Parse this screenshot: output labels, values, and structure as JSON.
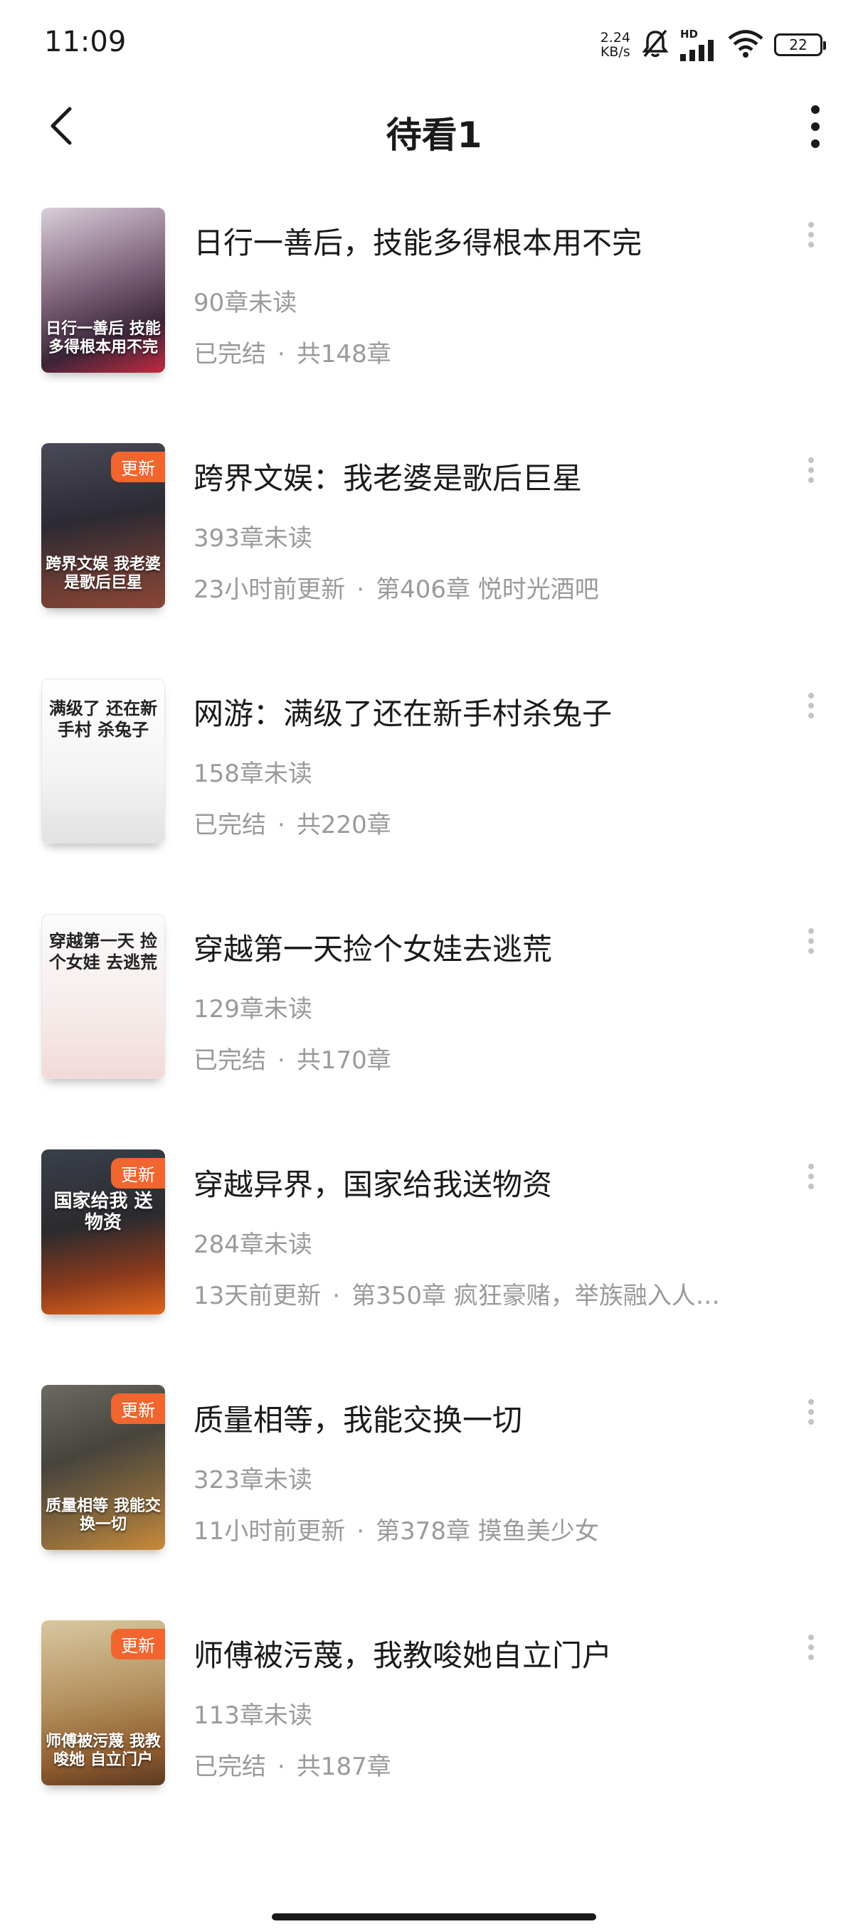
{
  "status_bar": {
    "time": "11:09",
    "net_speed_value": "2.24",
    "net_speed_unit": "KB/s",
    "signal_tag": "HD",
    "battery": "22"
  },
  "header": {
    "title": "待看1"
  },
  "colors": {
    "badge": "#f1652f",
    "secondary_text": "#9a9a9a",
    "primary_text": "#1a1a1a"
  },
  "books": [
    {
      "title": "日行一善后，技能多得根本用不完",
      "unread": "90章未读",
      "status": "已完结",
      "detail": "共148章",
      "badge": "",
      "cover_text": "日行一善后 技能多得根本用不完"
    },
    {
      "title": "跨界文娱：我老婆是歌后巨星",
      "unread": "393章未读",
      "status": "23小时前更新",
      "detail": "第406章 悦时光酒吧",
      "badge": "更新",
      "cover_text": "跨界文娱 我老婆是歌后巨星"
    },
    {
      "title": "网游：满级了还在新手村杀兔子",
      "unread": "158章未读",
      "status": "已完结",
      "detail": "共220章",
      "badge": "",
      "cover_text": "满级了 还在新手村 杀兔子"
    },
    {
      "title": "穿越第一天捡个女娃去逃荒",
      "unread": "129章未读",
      "status": "已完结",
      "detail": "共170章",
      "badge": "",
      "cover_text": "穿越第一天 捡个女娃 去逃荒"
    },
    {
      "title": "穿越异界，国家给我送物资",
      "unread": "284章未读",
      "status": "13天前更新",
      "detail": "第350章 疯狂豪赌，举族融入人…",
      "badge": "更新",
      "cover_text": "国家给我 送物资"
    },
    {
      "title": "质量相等，我能交换一切",
      "unread": "323章未读",
      "status": "11小时前更新",
      "detail": "第378章 摸鱼美少女",
      "badge": "更新",
      "cover_text": "质量相等 我能交换一切"
    },
    {
      "title": "师傅被污蔑，我教唆她自立门户",
      "unread": "113章未读",
      "status": "已完结",
      "detail": "共187章",
      "badge": "更新",
      "cover_text": "师傅被污蔑 我教唆她 自立门户"
    }
  ]
}
